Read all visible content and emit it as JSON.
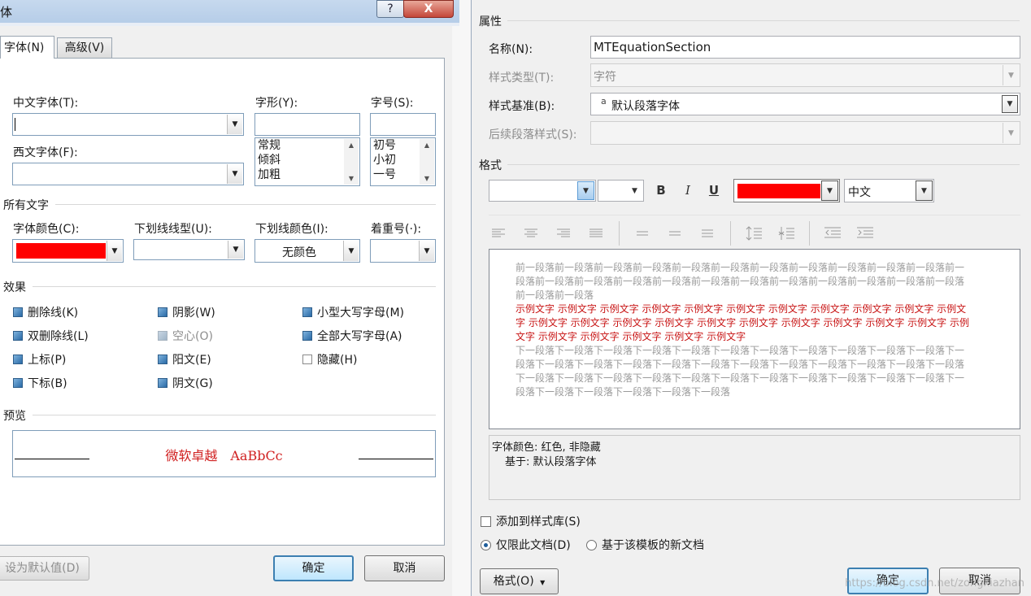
{
  "left": {
    "title": "体",
    "help_label": "?",
    "close_label": "X",
    "tabs": [
      {
        "label": "字体(N)"
      },
      {
        "label": "高级(V)"
      }
    ],
    "chinese_font": {
      "label": "中文字体(T):",
      "value": ""
    },
    "western_font": {
      "label": "西文字体(F):",
      "value": ""
    },
    "font_style": {
      "label": "字形(Y):",
      "value": "",
      "options": [
        "常规",
        "倾斜",
        "加粗"
      ]
    },
    "font_size": {
      "label": "字号(S):",
      "value": "",
      "options": [
        "初号",
        "小初",
        "一号"
      ]
    },
    "all_text_section": "所有文字",
    "font_color": {
      "label": "字体颜色(C):",
      "color": "#ff0000"
    },
    "underline_type": {
      "label": "下划线线型(U):",
      "value": ""
    },
    "underline_color": {
      "label": "下划线颜色(I):",
      "value": "无颜色"
    },
    "emphasis": {
      "label": "着重号(·):",
      "value": ""
    },
    "effects_section": "效果",
    "effects": [
      {
        "label": "删除线(K)",
        "state": "checked"
      },
      {
        "label": "双删除线(L)",
        "state": "checked"
      },
      {
        "label": "上标(P)",
        "state": "checked"
      },
      {
        "label": "下标(B)",
        "state": "checked"
      },
      {
        "label": "阴影(W)",
        "state": "checked"
      },
      {
        "label": "空心(O)",
        "state": "disabled"
      },
      {
        "label": "阳文(E)",
        "state": "checked"
      },
      {
        "label": "阴文(G)",
        "state": "checked"
      },
      {
        "label": "小型大写字母(M)",
        "state": "checked"
      },
      {
        "label": "全部大写字母(A)",
        "state": "checked"
      },
      {
        "label": "隐藏(H)",
        "state": "unchecked"
      }
    ],
    "preview_section": "预览",
    "preview_text": "微软卓越　AaBbCc",
    "set_default_label": "设为默认值(D)",
    "ok_label": "确定",
    "cancel_label": "取消"
  },
  "right": {
    "properties_section": "属性",
    "name": {
      "label": "名称(N):",
      "value": "MTEquationSection"
    },
    "style_type": {
      "label": "样式类型(T):",
      "value": "字符"
    },
    "style_based_on": {
      "label": "样式基准(B):",
      "icon_text": "a",
      "value": "默认段落字体"
    },
    "next_style": {
      "label": "后续段落样式(S):",
      "value": ""
    },
    "format_section": "格式",
    "font_value": "",
    "size_value": "",
    "bold_label": "B",
    "italic_label": "I",
    "underline_label": "U",
    "color_swatch": "#ff0000",
    "lang_value": "中文",
    "preview": {
      "before": "前一段落前一段落前一段落前一段落前一段落前一段落前一段落前一段落前一段落前一段落前一段落前一段落前一段落前一段落前一段落前一段落前一段落前一段落前一段落前一段落前一段落前一段落前一段落前一段落前一段落",
      "sample": "示例文字 示例文字 示例文字 示例文字 示例文字 示例文字 示例文字 示例文字 示例文字 示例文字 示例文字 示例文字 示例文字 示例文字 示例文字 示例文字 示例文字 示例文字 示例文字 示例文字 示例文字 示例文字 示例文字 示例文字 示例文字 示例文字 示例文字",
      "after": "下一段落下一段落下一段落下一段落下一段落下一段落下一段落下一段落下一段落下一段落下一段落下一段落下一段落下一段落下一段落下一段落下一段落下一段落下一段落下一段落下一段落下一段落下一段落下一段落下一段落下一段落下一段落下一段落下一段落下一段落下一段落下一段落下一段落下一段落下一段落下一段落下一段落下一段落下一段落下一段落"
    },
    "description_line1": "字体颜色: 红色, 非隐藏",
    "description_line2": "基于: 默认段落字体",
    "add_to_gallery": "添加到样式库(S)",
    "only_this_doc": "仅限此文档(D)",
    "new_docs_template": "基于该模板的新文档",
    "format_button": "格式(O)",
    "ok_label": "确定",
    "cancel_label": "取消",
    "watermark": "https://blog.csdn.net/zongxiazhan"
  }
}
